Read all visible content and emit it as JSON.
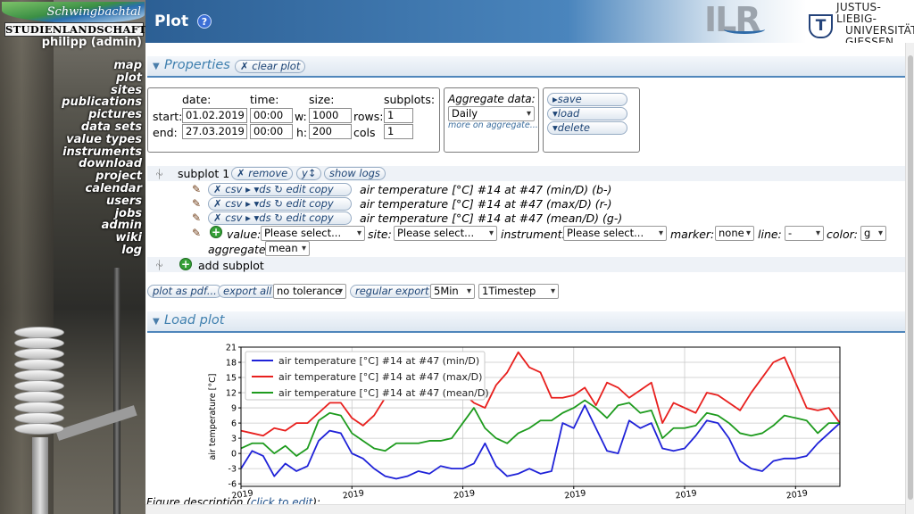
{
  "brand": {
    "script": "Schwingbachtal",
    "main": "STUDIENLANDSCHAFT"
  },
  "user": "philipp (admin)",
  "nav": [
    "map",
    "plot",
    "sites",
    "publications",
    "pictures",
    "data sets",
    "value types",
    "instruments",
    "download",
    "project",
    "calendar",
    "users",
    "jobs",
    "admin",
    "wiki",
    "log"
  ],
  "header": {
    "title": "Plot",
    "help_icon": "?",
    "ilr": "ILR",
    "jlu_mark": "T",
    "jlu_line1": "JUSTUS-LIEBIG-",
    "jlu_line2": "UNIVERSITÄT",
    "jlu_line3": "GIESSEN"
  },
  "properties": {
    "title": "Properties",
    "clear_plot": "✗ clear plot",
    "date_label": "date:",
    "time_label": "time:",
    "size_label": "size:",
    "subplots_label": "subplots:",
    "start_label": "start:",
    "end_label": "end:",
    "w_label": "w:",
    "h_label": "h:",
    "rows_label": "rows:",
    "cols_label": "cols",
    "start_date": "01.02.2019",
    "start_time": "00:00",
    "width": "1000",
    "rows": "1",
    "end_date": "27.03.2019",
    "end_time": "00:00",
    "height": "200",
    "cols": "1",
    "aggregate_label": "Aggregate data:",
    "aggregate_value": "Daily",
    "more_aggregate": "more on aggregate...",
    "save": "save",
    "load": "load",
    "delete": "delete"
  },
  "subplot": {
    "title": "subplot 1",
    "remove": "✗ remove",
    "y_btn": "y↕",
    "show_logs": "show logs",
    "lines": [
      {
        "tools": "✗ csv ▸  ▾ds ↻ edit copy",
        "label": "air temperature [°C] #14 at #47 (min/D) (b-)"
      },
      {
        "tools": "✗ csv ▸  ▾ds ↻ edit copy",
        "label": "air temperature [°C] #14 at #47 (max/D) (r-)"
      },
      {
        "tools": "✗ csv ▸  ▾ds ↻ edit copy",
        "label": "air temperature [°C] #14 at #47 (mean/D) (g-)"
      }
    ],
    "new_line": {
      "value_label": "value:",
      "value_select": "Please select...",
      "site_label": "site:",
      "site_select": "Please select...",
      "instrument_label": "instrument:",
      "instrument_select": "Please select...",
      "marker_label": "marker:",
      "marker_select": "none",
      "line_label": "line:",
      "line_select": "-",
      "color_label": "color:",
      "color_select": "g",
      "aggregate_label": "aggregate:",
      "aggregate_select": "mean"
    },
    "add_subplot": "add subplot"
  },
  "export": {
    "plot_pdf": "plot as pdf...",
    "export_all": "export all",
    "tolerance": "no tolerance",
    "regular_export": "regular export",
    "interval": "5Min",
    "timestep": "1Timestep"
  },
  "load_plot": {
    "title": "Load plot"
  },
  "figure": {
    "desc_prefix": "Figure description (",
    "desc_link": "click to edit",
    "desc_suffix": "):"
  },
  "colors": {
    "min": "#1f22d8",
    "max": "#e8201e",
    "mean": "#1e9b1e",
    "accent": "#4f86bb"
  },
  "chart_data": {
    "type": "line",
    "ylabel": "air temperature [°C]",
    "yticks": [
      -6,
      -3,
      0,
      3,
      6,
      9,
      12,
      15,
      18,
      21
    ],
    "ylim": [
      -6.5,
      21
    ],
    "xlim": [
      0,
      54
    ],
    "xtick_positions": [
      0,
      10,
      20,
      30,
      40,
      50
    ],
    "xtick_labels": [
      "2019",
      "2019",
      "2019",
      "2019",
      "2019",
      "2019"
    ],
    "legend": "top-left",
    "grid": true,
    "series": [
      {
        "name": "air temperature [°C] #14 at #47 (min/D)",
        "color": "#1f22d8",
        "values": [
          -3,
          0.5,
          -0.5,
          -4.5,
          -2,
          -3.5,
          -2.5,
          2.5,
          4.5,
          4,
          0,
          -1,
          -3,
          -4.5,
          -5,
          -4.5,
          -3.5,
          -4,
          -2.5,
          -3,
          -3,
          -2,
          2,
          -2.5,
          -4.5,
          -4,
          -3,
          -4,
          -3.5,
          6,
          5,
          9.5,
          5,
          0.5,
          0,
          6.5,
          5,
          6,
          1,
          0.5,
          1,
          3.5,
          6.5,
          6,
          3,
          -1.5,
          -3,
          -3.5,
          -1.5,
          -1,
          -1,
          -0.5,
          2,
          4,
          6
        ]
      },
      {
        "name": "air temperature [°C] #14 at #47 (max/D)",
        "color": "#e8201e",
        "values": [
          4.5,
          4,
          3.5,
          5,
          4.5,
          6,
          6,
          8,
          10,
          10,
          7,
          5.5,
          7.5,
          11,
          13,
          14,
          14,
          12,
          13.5,
          15,
          12,
          10,
          9,
          13.5,
          16,
          20,
          17,
          16,
          11,
          11,
          11.5,
          13,
          9.5,
          14,
          13,
          11,
          12.5,
          14,
          6,
          10,
          9,
          8,
          12,
          11.5,
          10,
          8.5,
          12,
          15,
          18,
          19,
          14,
          9,
          8.5,
          9,
          6
        ]
      },
      {
        "name": "air temperature [°C] #14 at #47 (mean/D)",
        "color": "#1e9b1e",
        "values": [
          1,
          2,
          2,
          0,
          1.5,
          -0.5,
          1,
          6.5,
          8,
          7.5,
          4,
          2.5,
          1,
          0.5,
          2,
          2,
          2,
          2.5,
          2.5,
          3,
          6,
          9,
          5,
          3,
          2,
          4,
          5,
          6.5,
          6.5,
          8,
          9,
          10.5,
          9,
          7,
          9.5,
          10,
          8,
          8.5,
          3,
          5,
          5,
          5.5,
          8,
          7.5,
          6,
          4,
          3.5,
          4,
          5.5,
          7.5,
          7,
          6.5,
          4,
          6,
          6
        ]
      }
    ]
  }
}
